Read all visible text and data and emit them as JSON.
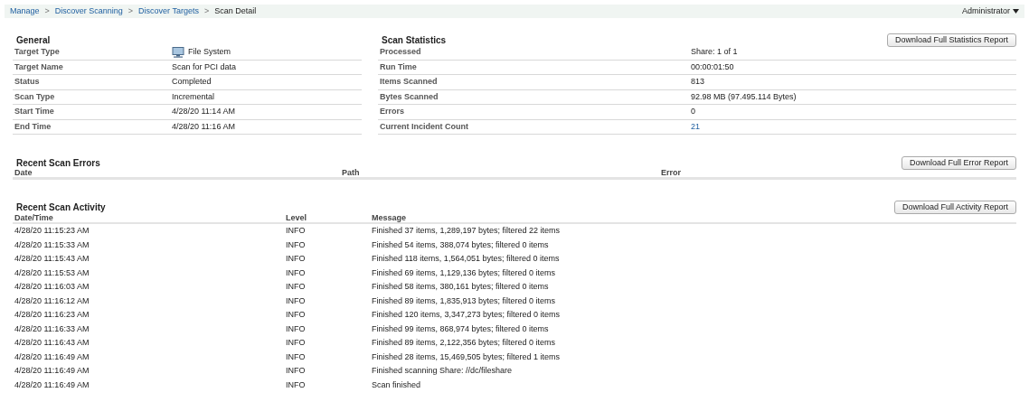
{
  "breadcrumb": [
    {
      "label": "Manage",
      "kind": "link"
    },
    {
      "label": "Discover Scanning",
      "kind": "link"
    },
    {
      "label": "Discover Targets",
      "kind": "link"
    },
    {
      "label": "Scan Detail",
      "kind": "current"
    }
  ],
  "breadcrumb_separator": ">",
  "user_menu": {
    "label": "Administrator"
  },
  "general": {
    "title": "General",
    "rows": [
      {
        "label": "Target Type",
        "value": "File System",
        "kind": "icon"
      },
      {
        "label": "Target Name",
        "value": "Scan for PCI data",
        "kind": "text"
      },
      {
        "label": "Status",
        "value": "Completed",
        "kind": "text"
      },
      {
        "label": "Scan Type",
        "value": "Incremental",
        "kind": "text"
      },
      {
        "label": "Start Time",
        "value": "4/28/20 11:14 AM",
        "kind": "text"
      },
      {
        "label": "End Time",
        "value": "4/28/20 11:16 AM",
        "kind": "text"
      }
    ]
  },
  "statistics": {
    "title": "Scan Statistics",
    "button": "Download Full Statistics Report",
    "rows": [
      {
        "label": "Processed",
        "value": "Share: 1 of 1",
        "kind": "text"
      },
      {
        "label": "Run Time",
        "value": "00:00:01:50",
        "kind": "text"
      },
      {
        "label": "Items Scanned",
        "value": "813",
        "kind": "text"
      },
      {
        "label": "Bytes Scanned",
        "value": "92.98 MB (97.495.114 Bytes)",
        "kind": "text"
      },
      {
        "label": "Errors",
        "value": "0",
        "kind": "text"
      },
      {
        "label": "Current Incident Count",
        "value": "21",
        "kind": "link"
      }
    ]
  },
  "errors": {
    "title": "Recent Scan Errors",
    "button": "Download Full Error Report",
    "columns": [
      "Date",
      "Path",
      "Error"
    ]
  },
  "activity": {
    "title": "Recent Scan Activity",
    "button": "Download Full Activity Report",
    "columns": [
      "Date/Time",
      "Level",
      "Message"
    ],
    "rows": [
      [
        "4/28/20 11:15:23 AM",
        "INFO",
        "Finished 37 items, 1,289,197 bytes; filtered 22 items"
      ],
      [
        "4/28/20 11:15:33 AM",
        "INFO",
        "Finished 54 items, 388,074 bytes; filtered 0 items"
      ],
      [
        "4/28/20 11:15:43 AM",
        "INFO",
        "Finished 118 items, 1,564,051 bytes; filtered 0 items"
      ],
      [
        "4/28/20 11:15:53 AM",
        "INFO",
        "Finished 69 items, 1,129,136 bytes; filtered 0 items"
      ],
      [
        "4/28/20 11:16:03 AM",
        "INFO",
        "Finished 58 items, 380,161 bytes; filtered 0 items"
      ],
      [
        "4/28/20 11:16:12 AM",
        "INFO",
        "Finished 89 items, 1,835,913 bytes; filtered 0 items"
      ],
      [
        "4/28/20 11:16:23 AM",
        "INFO",
        "Finished 120 items, 3,347,273 bytes; filtered 0 items"
      ],
      [
        "4/28/20 11:16:33 AM",
        "INFO",
        "Finished 99 items, 868,974 bytes; filtered 0 items"
      ],
      [
        "4/28/20 11:16:43 AM",
        "INFO",
        "Finished 89 items, 2,122,356 bytes; filtered 0 items"
      ],
      [
        "4/28/20 11:16:49 AM",
        "INFO",
        "Finished 28 items, 15,469,505 bytes; filtered 1 items"
      ],
      [
        "4/28/20 11:16:49 AM",
        "INFO",
        "Finished scanning Share: //dc/fileshare"
      ],
      [
        "4/28/20 11:16:49 AM",
        "INFO",
        "Scan finished"
      ]
    ]
  }
}
